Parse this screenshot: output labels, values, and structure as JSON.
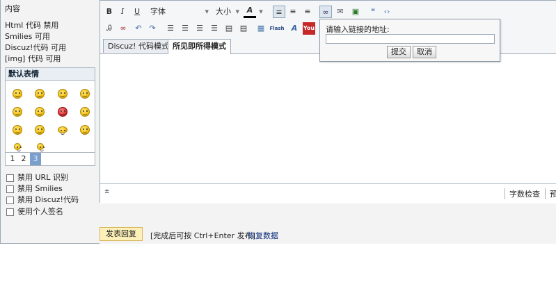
{
  "left": {
    "section_title": "内容",
    "options": [
      "Html 代码 禁用",
      "Smilies 可用",
      "Discuz!代码 可用",
      "[img] 代码 可用"
    ],
    "smilies_title": "默认表情",
    "pages": [
      "1",
      "2",
      "3"
    ],
    "checkboxes": [
      "禁用 URL 识别",
      "禁用 Smilies",
      "禁用 Discuz!代码",
      "使用个人签名"
    ]
  },
  "toolbar": {
    "bold": "B",
    "italic": "I",
    "underline": "U",
    "font_select": "字体",
    "size_select": "大小",
    "font_color": "A",
    "flash": "Flash",
    "youtube": "You"
  },
  "tabs": [
    "Discuz! 代码模式",
    "所见即所得模式"
  ],
  "status": {
    "resize": "±",
    "wordcount": "字数检查",
    "preview": "预"
  },
  "link_popup": {
    "label": "请输入链接的地址:",
    "input_value": "",
    "submit": "提交",
    "cancel": "取消"
  },
  "bottom": {
    "submit": "发表回复",
    "hint": "[完成后可按 Ctrl+Enter 发布]",
    "restore": "恢复数据"
  }
}
